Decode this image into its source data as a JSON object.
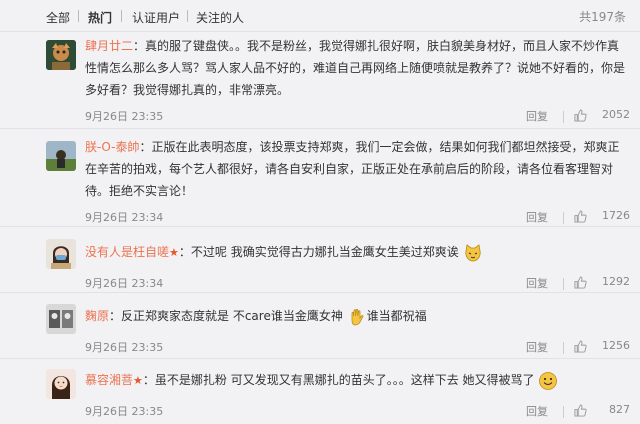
{
  "filters": {
    "all": "全部",
    "hot": "热门",
    "verified": "认证用户",
    "following": "关注的人",
    "total": "共197条"
  },
  "comments": [
    {
      "author": "肆月廿二",
      "text": "：真的服了键盘侠。。我不是粉丝，我觉得娜扎很好啊，肤白貌美身材好，而且人家不炒作真性情怎么那么多人骂？骂人家人品不好的，难道自己再网络上随便喷就是教养了？说她不好看的，你是多好看？我觉得娜扎真的，非常漂亮。",
      "time": "9月26日 23:35",
      "reply": "回复",
      "likes": "2052"
    },
    {
      "author": "朕-O-泰帥",
      "text": "：正版在此表明态度，该投票支持郑爽，我们一定会做，结果如何我们都坦然接受，郑爽正在辛苦的拍戏，每个艺人都很好，请各自安利自家，正版正处在承前启后的阶段，请各位看客理智对待。拒绝不实言论！",
      "time": "9月26日 23:34",
      "reply": "回复",
      "likes": "1726"
    },
    {
      "author": "没有人是枉自嗟",
      "text_a": "：不过呢 我确实觉得古力娜扎当金鹰女生美过郑爽诶",
      "time": "9月26日 23:34",
      "reply": "回复",
      "likes": "1292"
    },
    {
      "author": "麴原",
      "text_a": "：反正郑爽家态度就是 不care谁当金鹰女神",
      "text_b": "谁当都祝福",
      "time": "9月26日 23:35",
      "reply": "回复",
      "likes": "1256"
    },
    {
      "author": "慕容湘菩",
      "text_a": "：虽不是娜扎粉 可又发现又有黑娜扎的苗头了。。。这样下去 她又得被骂了",
      "time": "9月26日 23:35",
      "reply": "回复",
      "likes": "827"
    }
  ],
  "icons": {
    "like": "thumbs-up-icon",
    "star": "★",
    "emoji_cat": "cat-face-emoji",
    "emoji_hand": "waving-hand-emoji",
    "emoji_smile": "smiley-emoji"
  },
  "colors": {
    "author": "#eb7350",
    "star": "#e8542a",
    "meta": "#888888"
  }
}
